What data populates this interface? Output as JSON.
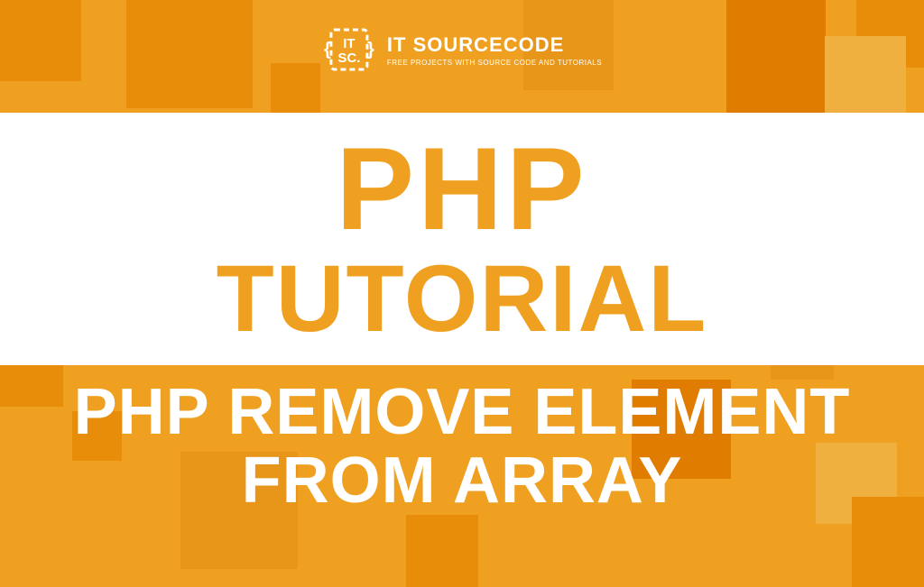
{
  "logo": {
    "title": "IT SOURCECODE",
    "subtitle": "FREE PROJECTS WITH SOURCE CODE AND TUTORIALS"
  },
  "main_title": {
    "line1": "PHP",
    "line2": "TUTORIAL"
  },
  "subtitle": {
    "line1": "PHP REMOVE ELEMENT",
    "line2": "FROM ARRAY"
  }
}
